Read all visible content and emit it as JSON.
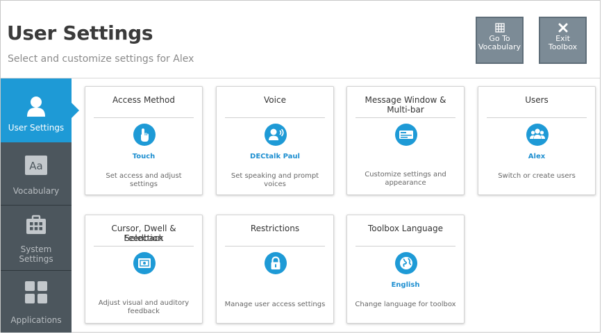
{
  "header": {
    "title": "User Settings",
    "subtitle": "Select and customize settings for Alex",
    "go_to_vocabulary": {
      "line1": "Go To",
      "line2": "Vocabulary",
      "icon": "grid-icon"
    },
    "exit_toolbox": {
      "line1": "Exit",
      "line2": "Toolbox",
      "icon": "close-icon"
    }
  },
  "sidebar": {
    "items": [
      {
        "label": "User Settings",
        "icon": "user-icon",
        "active": true
      },
      {
        "label": "Vocabulary",
        "icon": "aa-text-icon",
        "active": false
      },
      {
        "label1": "System",
        "label2": "Settings",
        "icon": "toolbox-icon",
        "active": false
      },
      {
        "label": "Applications",
        "icon": "apps-grid-icon",
        "active": false
      }
    ]
  },
  "cards": {
    "access_method": {
      "title": "Access Method",
      "value": "Touch",
      "desc": "Set access and adjust settings",
      "icon": "touch-hand-icon"
    },
    "voice": {
      "title": "Voice",
      "value": "DECtalk Paul",
      "desc": "Set speaking and prompt voices",
      "icon": "speaking-person-icon"
    },
    "message_window": {
      "title1": "Message Window &",
      "title2": "Multi-bar",
      "value": "",
      "desc1": "Customize settings and",
      "desc2": "appearance",
      "icon": "message-bar-icon"
    },
    "users": {
      "title": "Users",
      "value": "Alex",
      "desc": "Switch or create users",
      "icon": "users-group-icon"
    },
    "cursor": {
      "title1": "Cursor, Dwell & Selection",
      "title2": "Feedback",
      "value": "",
      "desc1": "Adjust visual and auditory",
      "desc2": "feedback",
      "icon": "cursor-feedback-icon"
    },
    "restrictions": {
      "title": "Restrictions",
      "value": "",
      "desc": "Manage user access settings",
      "icon": "lock-icon"
    },
    "toolbox_language": {
      "title": "Toolbox Language",
      "value": "English",
      "desc": "Change language for toolbox",
      "icon": "globe-icon"
    }
  },
  "colors": {
    "accent": "#1e9ad6",
    "sidebar": "#404a51",
    "header_button": "#7c8b96"
  }
}
